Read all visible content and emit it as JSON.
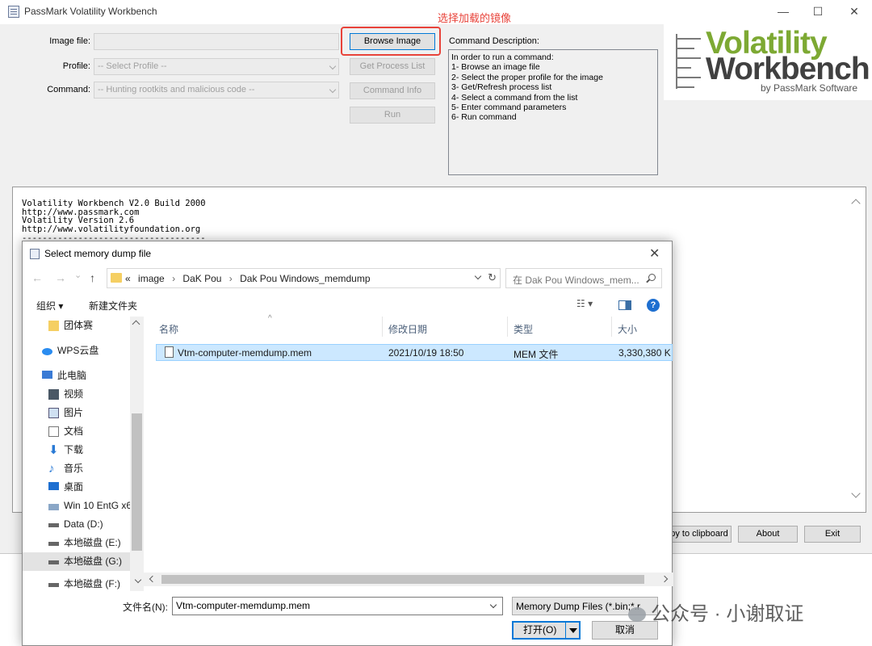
{
  "window": {
    "title": "PassMark Volatility Workbench",
    "controls": {
      "minimize": "—",
      "maximize": "☐",
      "close": "✕"
    }
  },
  "form": {
    "image_file_label": "Image file:",
    "image_file_value": "",
    "profile_label": "Profile:",
    "profile_value": "-- Select Profile --",
    "command_label": "Command:",
    "command_value": "-- Hunting rootkits and malicious code --"
  },
  "buttons": {
    "browse": "Browse Image",
    "get_process": "Get Process List",
    "command_info": "Command Info",
    "run": "Run",
    "copy_clipboard": "Copy to clipboard",
    "about": "About",
    "exit": "Exit"
  },
  "annotation": {
    "text": "选择加载的镜像",
    "color": "#e8433a"
  },
  "command_description": {
    "label": "Command Description:",
    "lines": [
      "In order to run a command:",
      "1- Browse an image file",
      "2- Select the proper profile for the image",
      "3- Get/Refresh process list",
      "4- Select a command from the list",
      "5- Enter command parameters",
      "6- Run command"
    ]
  },
  "logo": {
    "word1": "Volatility",
    "word2": "Workbench",
    "byline": "by PassMark Software",
    "green": "#7da933"
  },
  "output": {
    "lines": [
      "Volatility Workbench V2.0 Build 2000",
      "http://www.passmark.com",
      "Volatility Version 2.6",
      "http://www.volatilityfoundation.org",
      "------------------------------------"
    ]
  },
  "dialog": {
    "title": "Select memory dump file",
    "close": "✕",
    "nav": {
      "back": "←",
      "forward": "→",
      "recent": "⌄",
      "up": "↑"
    },
    "breadcrumb": [
      "«",
      "image",
      "›",
      "DaK Pou",
      "›",
      "Dak Pou Windows_memdump"
    ],
    "refresh": "↻",
    "search_placeholder": "在 Dak Pou Windows_mem...",
    "organize": "组织 ▾",
    "new_folder": "新建文件夹",
    "view_menu": "☷ ▾",
    "help": "?",
    "nav_items": [
      {
        "label": "团体赛",
        "icon": "folder-icon"
      },
      {
        "label": "WPS云盘",
        "icon": "cloud-icon"
      },
      {
        "label": "此电脑",
        "icon": "computer-icon"
      },
      {
        "label": "视频",
        "icon": "video-icon"
      },
      {
        "label": "图片",
        "icon": "picture-icon"
      },
      {
        "label": "文档",
        "icon": "document-icon"
      },
      {
        "label": "下载",
        "icon": "download-icon"
      },
      {
        "label": "音乐",
        "icon": "music-icon"
      },
      {
        "label": "桌面",
        "icon": "desktop-icon"
      },
      {
        "label": "Win 10 EntG x6",
        "icon": "network-drive-icon"
      },
      {
        "label": "Data (D:)",
        "icon": "drive-icon"
      },
      {
        "label": "本地磁盘 (E:)",
        "icon": "drive-icon"
      },
      {
        "label": "本地磁盘 (G:)",
        "icon": "drive-icon"
      },
      {
        "label": "本地磁盘 (F:)",
        "icon": "drive-icon"
      }
    ],
    "columns": [
      "名称",
      "修改日期",
      "类型",
      "大小"
    ],
    "files": [
      {
        "name": "Vtm-computer-memdump.mem",
        "modified": "2021/10/19 18:50",
        "type": "MEM 文件",
        "size": "3,330,380 K"
      }
    ],
    "filename_label": "文件名(N):",
    "filename_value": "Vtm-computer-memdump.mem",
    "filetype_value": "Memory Dump Files (*.bin;*.r",
    "open": "打开(O)",
    "cancel": "取消"
  },
  "watermark": {
    "text": "公众号 · 小谢取证"
  }
}
